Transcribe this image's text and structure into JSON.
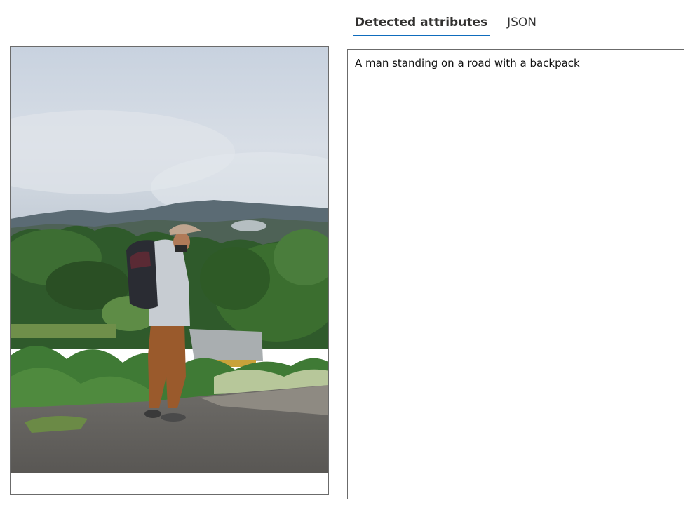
{
  "tabs": [
    {
      "label": "Detected attributes",
      "active": true
    },
    {
      "label": "JSON",
      "active": false
    }
  ],
  "results": {
    "caption": "A man standing on a road with a backpack"
  },
  "colors": {
    "accent": "#0f6cbd",
    "border": "#6b6b6b"
  }
}
